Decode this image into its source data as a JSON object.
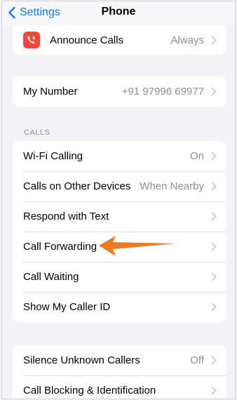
{
  "nav": {
    "back_label": "Settings",
    "title": "Phone"
  },
  "top_group": {
    "announce": {
      "label": "Announce Calls",
      "value": "Always"
    }
  },
  "number_group": {
    "my_number": {
      "label": "My Number",
      "value": "+91 97996 69977"
    }
  },
  "calls_section": {
    "header": "CALLS",
    "items": [
      {
        "label": "Wi-Fi Calling",
        "value": "On"
      },
      {
        "label": "Calls on Other Devices",
        "value": "When Nearby"
      },
      {
        "label": "Respond with Text",
        "value": ""
      },
      {
        "label": "Call Forwarding",
        "value": ""
      },
      {
        "label": "Call Waiting",
        "value": ""
      },
      {
        "label": "Show My Caller ID",
        "value": ""
      }
    ]
  },
  "bottom_group": {
    "items": [
      {
        "label": "Silence Unknown Callers",
        "value": "Off"
      },
      {
        "label": "Call Blocking & Identification",
        "value": ""
      }
    ]
  },
  "colors": {
    "accent": "#0a7aff",
    "background": "#f2f2f7",
    "announce_icon_bg": "#f2483b",
    "annotation_arrow": "#f07a1f"
  },
  "icons": {
    "back": "chevron-left-icon",
    "announce": "phone-announce-icon",
    "row_disclosure": "chevron-right-icon",
    "annotation": "orange-arrow-annotation"
  }
}
